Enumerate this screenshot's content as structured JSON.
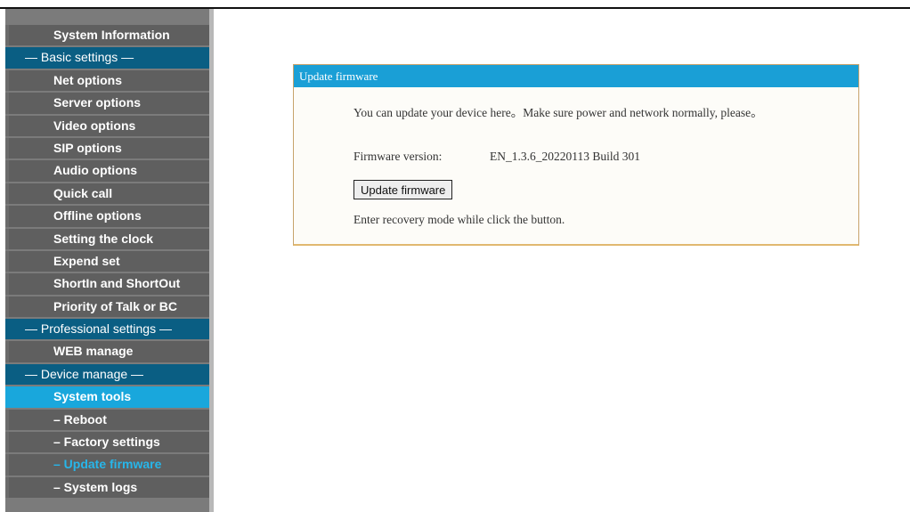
{
  "sidebar": {
    "items": [
      {
        "label": "System Information"
      },
      {
        "label": "— Basic settings —"
      },
      {
        "label": "Net options"
      },
      {
        "label": "Server options"
      },
      {
        "label": "Video options"
      },
      {
        "label": "SIP options"
      },
      {
        "label": "Audio options"
      },
      {
        "label": "Quick call"
      },
      {
        "label": "Offline options"
      },
      {
        "label": "Setting the clock"
      },
      {
        "label": "Expend set"
      },
      {
        "label": "ShortIn and ShortOut"
      },
      {
        "label": "Priority of Talk or BC"
      },
      {
        "label": "— Professional settings —"
      },
      {
        "label": "WEB manage"
      },
      {
        "label": "— Device manage —"
      },
      {
        "label": "System tools"
      },
      {
        "label": "– Reboot"
      },
      {
        "label": "– Factory settings"
      },
      {
        "label": "– Update firmware"
      },
      {
        "label": "– System logs"
      }
    ]
  },
  "panel": {
    "title": "Update firmware",
    "description": "You can update your device here。Make sure power and network normally, please。",
    "firmware_label": "Firmware version:",
    "firmware_value": "EN_1.3.6_20220113 Build 301",
    "button_label": "Update firmware",
    "hint": "Enter recovery mode while click the button."
  },
  "colors": {
    "sidebar_bg": "#7b7b7b",
    "menu_item_bg": "#5f5f5f",
    "section_bg": "#0a5e83",
    "active_bg": "#19a7dc",
    "current_text": "#27b6ea",
    "panel_header_bg": "#1a9fd6",
    "panel_border": "#e1b870"
  }
}
